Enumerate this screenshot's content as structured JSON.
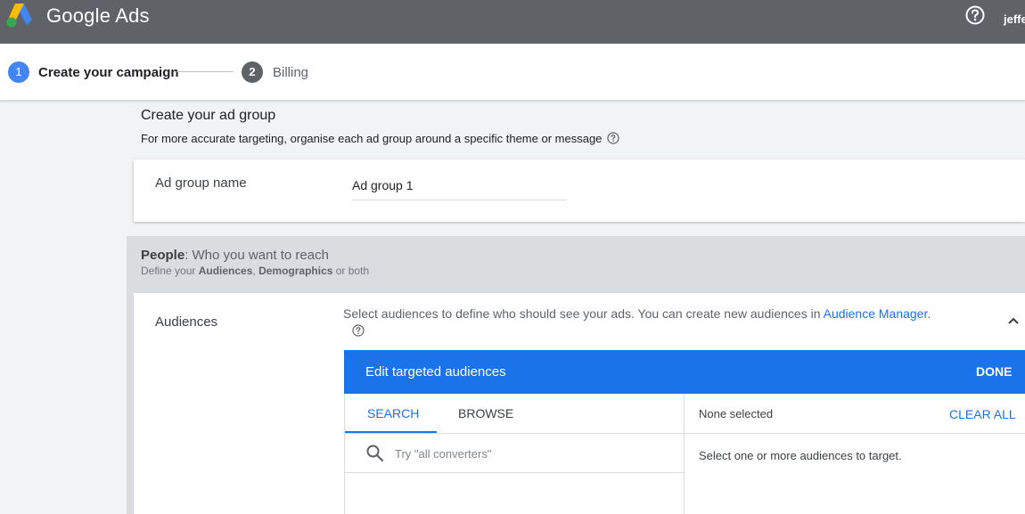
{
  "header": {
    "brand": "Google Ads",
    "user": "jeffe",
    "icons": {
      "logo": "google-ads-logo",
      "help": "help-icon"
    }
  },
  "stepper": {
    "steps": [
      {
        "number": "1",
        "label": "Create your campaign",
        "state": "active"
      },
      {
        "number": "2",
        "label": "Billing",
        "state": "inactive"
      }
    ]
  },
  "ad_group": {
    "title": "Create your ad group",
    "subtitle": "For more accurate targeting, organise each ad group around a specific theme or message",
    "name_label": "Ad group name",
    "name_value": "Ad group 1"
  },
  "people": {
    "title_bold": "People",
    "title_rest": ": Who you want to reach",
    "sub_prefix": "Define your ",
    "sub_audiences": "Audiences",
    "sub_comma": ", ",
    "sub_demographics": "Demographics",
    "sub_suffix": " or both"
  },
  "audiences": {
    "label": "Audiences",
    "description": "Select audiences to define who should see your ads.  You can create new audiences in ",
    "link": "Audience Manager",
    "period": "."
  },
  "editor": {
    "title": "Edit targeted audiences",
    "done": "DONE",
    "tabs": [
      "SEARCH",
      "BROWSE"
    ],
    "active_tab": "SEARCH",
    "search_placeholder": "Try \"all converters\"",
    "none_selected": "None selected",
    "clear_all": "CLEAR ALL",
    "empty_message": "Select one or more audiences to target."
  },
  "colors": {
    "topbar": "#5f6368",
    "accent": "#1a73e8",
    "step_active": "#4285f4"
  }
}
